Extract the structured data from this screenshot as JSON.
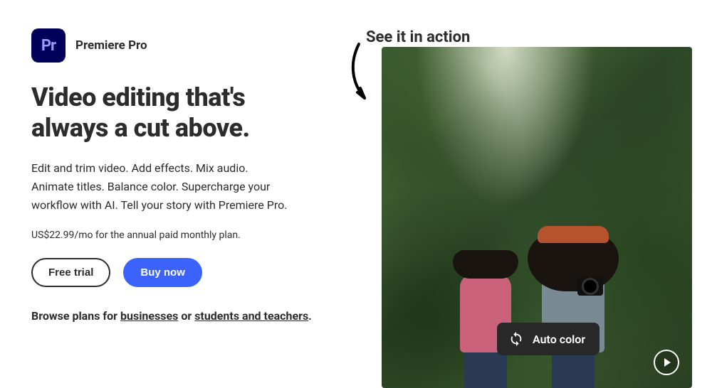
{
  "app": {
    "icon_text": "Pr",
    "name": "Premiere Pro"
  },
  "hero": {
    "headline": "Video editing that's always a cut above.",
    "description": "Edit and trim video. Add effects. Mix audio. Animate titles. Balance color. Supercharge your workflow with AI. Tell your story with Premiere Pro.",
    "price": "US$22.99/mo for the annual paid monthly plan."
  },
  "buttons": {
    "free_trial": "Free trial",
    "buy_now": "Buy now"
  },
  "plans": {
    "prefix": "Browse plans for ",
    "link_business": "businesses",
    "middle": " or ",
    "link_students": "students and teachers",
    "suffix": "."
  },
  "preview": {
    "see_label": "See it in action",
    "badge_label": "Auto color"
  },
  "colors": {
    "primary_button": "#3b63fb",
    "app_icon_bg": "#00005b",
    "app_icon_fg": "#9999ff"
  }
}
